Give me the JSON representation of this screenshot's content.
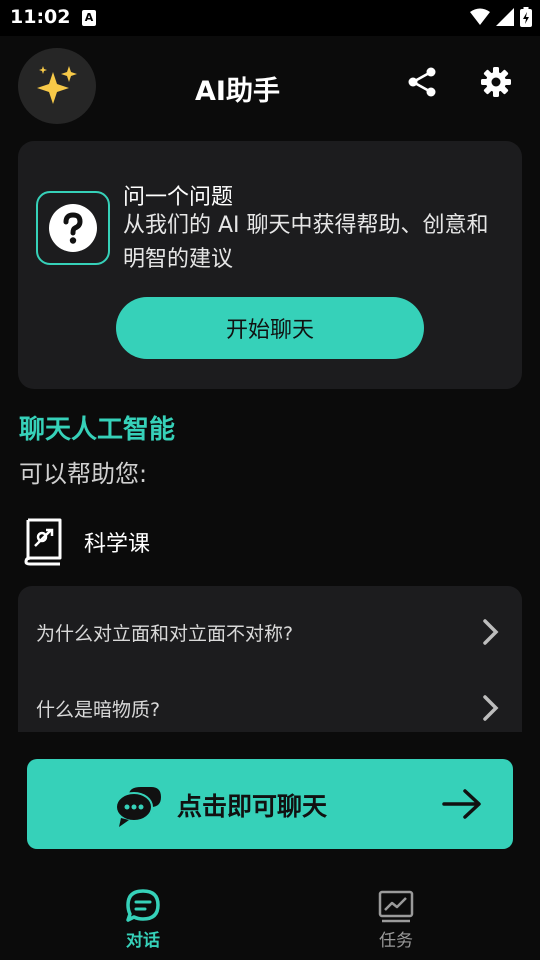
{
  "status_bar": {
    "time": "11:02",
    "notif_letter": "A"
  },
  "header": {
    "title": "AI助手"
  },
  "ask_card": {
    "title": "问一个问题",
    "description": "从我们的 AI 聊天中获得帮助、创意和明智的建议",
    "button_label": "开始聊天"
  },
  "section": {
    "title": "聊天人工智能",
    "subtitle": "可以帮助您:"
  },
  "topic": {
    "label": "科学课"
  },
  "questions": [
    {
      "text": "为什么对立面和对立面不对称?"
    },
    {
      "text": "什么是暗物质?"
    }
  ],
  "chat_button": {
    "label": "点击即可聊天"
  },
  "tabs": [
    {
      "label": "对话",
      "icon": "chat-bubble-icon",
      "active": true
    },
    {
      "label": "任务",
      "icon": "chart-icon",
      "active": false
    }
  ],
  "colors": {
    "accent": "#36d1b9",
    "card": "#1c1c1e",
    "background": "#0b0b0b"
  }
}
